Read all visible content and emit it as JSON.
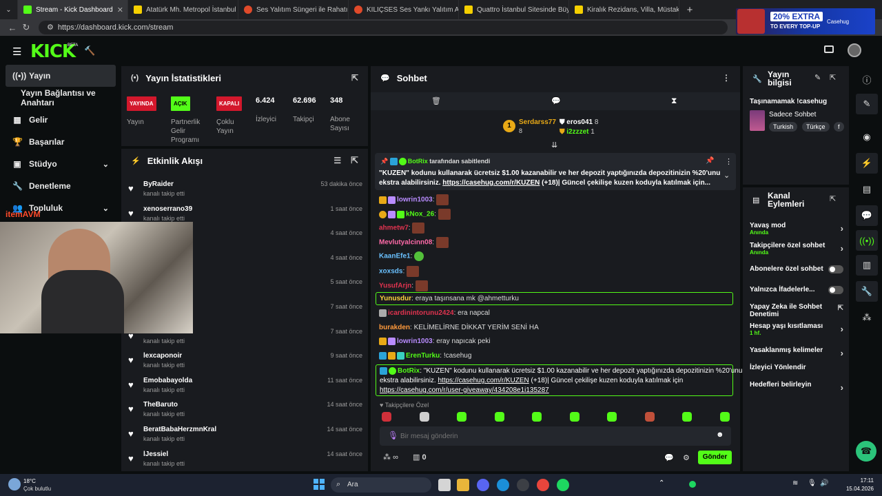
{
  "browser": {
    "tabs": [
      {
        "title": "Stream - Kick Dashboard",
        "color": "#53fc18",
        "active": true
      },
      {
        "title": "Atatürk Mh. Metropol İstanbul Kira",
        "color": "#f5d000"
      },
      {
        "title": "Ses Yalıtım Süngeri ile Rahatını",
        "color": "#e04a2a"
      },
      {
        "title": "KILIÇSES Ses Yankı Yalıtım Akustik",
        "color": "#e04a2a"
      },
      {
        "title": "Quattro İstanbul Sitesinde Büyük",
        "color": "#f5d000"
      },
      {
        "title": "Kiralık Rezidans, Villa, Müstakil Ev",
        "color": "#f5d000"
      }
    ],
    "url": "https://dashboard.kick.com/stream",
    "new_tab": "+",
    "ad": {
      "line1": "20% EXTRA",
      "line2": "TO EVERY TOP-UP",
      "brand": "Casehug"
    }
  },
  "kick": {
    "logo": "KICK",
    "logo_beta": "BETA"
  },
  "sidebar": {
    "items": [
      {
        "label": "Yayın",
        "icon": "broadcast-icon"
      },
      {
        "label": "Yayın Bağlantısı ve Anahtarı",
        "icon": ""
      },
      {
        "label": "Gelir",
        "icon": "chart-icon"
      },
      {
        "label": "Başarılar",
        "icon": "trophy-icon"
      },
      {
        "label": "Stüdyo",
        "icon": "studio-icon"
      },
      {
        "label": "Denetleme",
        "icon": "wrench-icon"
      },
      {
        "label": "Topluluk",
        "icon": "people-icon"
      }
    ],
    "webcam_overlay": "itemAVM"
  },
  "stats": {
    "title": "Yayın İstatistikleri",
    "badges": [
      {
        "badge": "YAYINDA",
        "label": "Yayın",
        "color": "#d3182c"
      },
      {
        "badge": "AÇIK",
        "label": "Partnerlik Gelir Programı",
        "color": "#53fc18"
      },
      {
        "badge": "KAPALI",
        "label": "Çoklu Yayın",
        "color": "#d3182c"
      }
    ],
    "numbers": [
      {
        "value": "6.424",
        "label": "İzleyici"
      },
      {
        "value": "62.696",
        "label": "Takipçi"
      },
      {
        "value": "348",
        "label": "Abone Sayısı"
      }
    ]
  },
  "activity": {
    "title": "Etkinlik Akışı",
    "rows": [
      {
        "name": "ByRaider",
        "action": "kanalı takip etti",
        "time": "53 dakika önce"
      },
      {
        "name": "xenoserrano39",
        "action": "kanalı takip etti",
        "time": "1 saat önce"
      },
      {
        "name": "",
        "action": "",
        "time": "4 saat önce"
      },
      {
        "name": "",
        "action": "",
        "time": "4 saat önce"
      },
      {
        "name": "",
        "action": "",
        "time": "5 saat önce"
      },
      {
        "name": "",
        "action": "",
        "time": "7 saat önce"
      },
      {
        "name": "",
        "action": "kanalı takip etti",
        "time": "7 saat önce"
      },
      {
        "name": "lexcaponoir",
        "action": "kanalı takip etti",
        "time": "9 saat önce"
      },
      {
        "name": "Emobabayolda",
        "action": "kanalı takip etti",
        "time": "11 saat önce"
      },
      {
        "name": "TheBaruto",
        "action": "kanalı takip etti",
        "time": "14 saat önce"
      },
      {
        "name": "BeratBabaHerzmnKral",
        "action": "kanalı takip etti",
        "time": "14 saat önce"
      },
      {
        "name": "lJessiel",
        "action": "kanalı takip etti",
        "time": "14 saat önce"
      }
    ]
  },
  "chat": {
    "title": "Sohbet",
    "leaders": [
      {
        "name": "Serdarss77",
        "count": "8",
        "rank": "1"
      },
      {
        "name": "eros041",
        "count": "8"
      },
      {
        "name": "i2zzzet",
        "count": "1"
      }
    ],
    "pinned": {
      "by": "BotRix",
      "by_suffix": "tarafından sabitlendi",
      "text1": "\"KUZEN\" kodunu kullanarak ücretsiz $1.00 kazanabilir ve her depozit yaptığınızda depozitinizin %20'unu",
      "text2_pre": "ekstra alabilirsiniz. ",
      "link": "https://casehug.com/r/KUZEN",
      "text2_post": " (+18)| Güncel çekilişe kuzen koduyla katılmak için..."
    },
    "messages": [
      {
        "user": "lowrin1003",
        "color": "#b98cff",
        "text": ""
      },
      {
        "user": "kNox_26",
        "color": "#53fc18",
        "text": ""
      },
      {
        "user": "ahmetw7",
        "color": "#e0334f",
        "text": ""
      },
      {
        "user": "Mevlutyalcinn08",
        "color": "#ff6aa8",
        "text": ""
      },
      {
        "user": "KaanEfe1",
        "color": "#6ac1ff",
        "text": ""
      },
      {
        "user": "xoxsds",
        "color": "#6ac1ff",
        "text": ""
      },
      {
        "user": "YusufArjn",
        "color": "#e0334f",
        "text": ""
      },
      {
        "user": "Yunusdur",
        "color": "#ffd23f",
        "text": "eraya taşınsana mk @ahmetturku",
        "highlight": true
      },
      {
        "user": "icardinintorunu2424",
        "color": "#e0334f",
        "text": "era napcal"
      },
      {
        "user": "burakden",
        "color": "#ff9a3c",
        "text": "KELİMELİRNE DİKKAT YERİM SENİ HA"
      },
      {
        "user": "lowrin1003",
        "color": "#b98cff",
        "text": "eray napıcak peki"
      },
      {
        "user": "ErenTurku",
        "color": "#53fc18",
        "text": "!casehug"
      }
    ],
    "bot_message": {
      "user": "BotRix",
      "line1": "\"KUZEN\" kodunu kullanarak ücretsiz $1.00 kazanabilir ve her depozit yaptığınızda depozitinizin %20'unu",
      "line2_pre": "ekstra alabilirsiniz. ",
      "link1": "https://casehug.com/r/KUZEN",
      "line2_post": " (+18)| Güncel çekilişe kuzen koduyla katılmak için",
      "link2": "https://casehug.com/r/user-giveaway/434208e1i135287"
    },
    "followers_only": "Takipçilere Özel",
    "input_placeholder": "Bir mesaj gönderin",
    "infinity": "∞",
    "store_count": "0",
    "send": "Gönder"
  },
  "stream_info": {
    "title": "Yayın bilgisi",
    "stream_title": "Taşınamamak !casehug",
    "category": "Sadece Sohbet",
    "tags": [
      "Turkish",
      "Türkçe",
      "f"
    ]
  },
  "channel_actions": {
    "title": "Kanal Eylemleri",
    "items": [
      {
        "label": "Yavaş mod",
        "sub": "Anında",
        "type": "chev"
      },
      {
        "label": "Takipçilere özel sohbet",
        "sub": "Anında",
        "type": "chev"
      },
      {
        "label": "Abonelere özel sohbet",
        "sub": "",
        "type": "toggle"
      },
      {
        "label": "Yalnızca İfadelerle...",
        "sub": "",
        "type": "toggle"
      },
      {
        "label": "Yapay Zeka ile Sohbet Denetimi",
        "sub": "",
        "type": "ext"
      },
      {
        "label": "Hesap yaşı kısıtlaması",
        "sub": "1 hf.",
        "type": "chev"
      },
      {
        "label": "Yasaklanmış kelimeler",
        "sub": "",
        "type": "chev"
      },
      {
        "label": "İzleyici Yönlendir",
        "sub": "",
        "type": "none"
      },
      {
        "label": "Hedefleri belirleyin",
        "sub": "",
        "type": "chev"
      }
    ]
  },
  "taskbar": {
    "weather_temp": "18°C",
    "weather_desc": "Çok bulutlu",
    "search": "Ara",
    "time": "17:11",
    "date": "15.04.2026"
  }
}
